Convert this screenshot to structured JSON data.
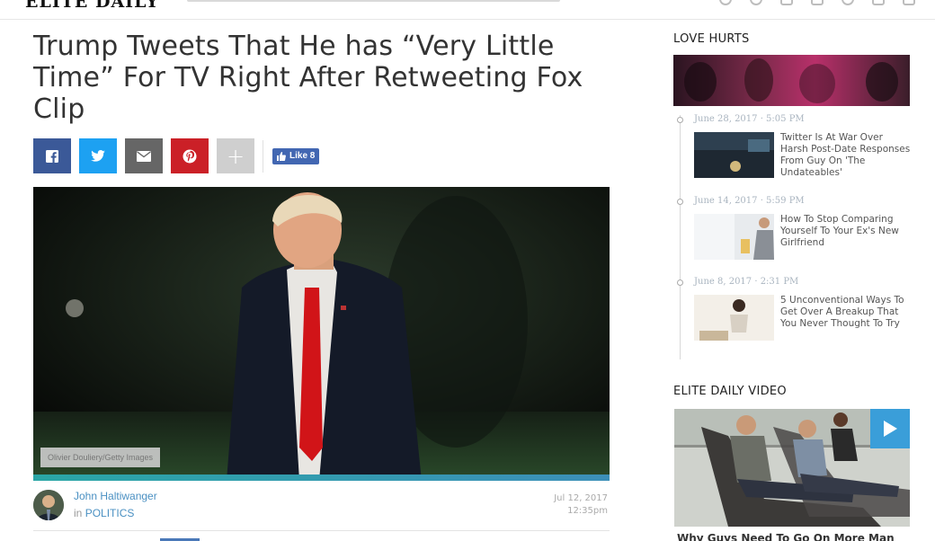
{
  "site": {
    "logo": "ELITE DAILY"
  },
  "article": {
    "headline": "Trump Tweets That He has “Very Little Time” For TV Right After Retweeting Fox Clip",
    "like_label": "Like 8",
    "photo_credit": "Olivier Douliery/Getty Images",
    "author": "John Haltiwanger",
    "section_prefix": "in",
    "section": "POLITICS",
    "date": "Jul 12, 2017",
    "time": "12:35pm"
  },
  "sidebar": {
    "love_hurts": {
      "heading": "LOVE HURTS",
      "items": [
        {
          "date": "June 28, 2017 · 5:05 PM",
          "title": "Twitter Is At War Over Harsh Post-Date Responses From Guy On 'The Undateables'"
        },
        {
          "date": "June 14, 2017 · 5:59 PM",
          "title": "How To Stop Comparing Yourself To Your Ex's New Girlfriend"
        },
        {
          "date": "June 8, 2017 · 2:31 PM",
          "title": "5 Unconventional Ways To Get Over A Breakup That You Never Thought To Try"
        }
      ]
    },
    "video": {
      "heading": "ELITE DAILY VIDEO",
      "caption": "Why Guys Need To Go On More Man"
    }
  },
  "colors": {
    "facebook": "#3b5998",
    "twitter": "#1da1f2",
    "email": "#666666",
    "pinterest": "#cb2027",
    "link": "#4a90c2",
    "play_button": "#3a9ed9"
  },
  "icons": [
    "facebook-icon",
    "twitter-icon",
    "email-icon",
    "pinterest-icon",
    "plus-icon",
    "thumbs-up-icon",
    "play-icon"
  ]
}
